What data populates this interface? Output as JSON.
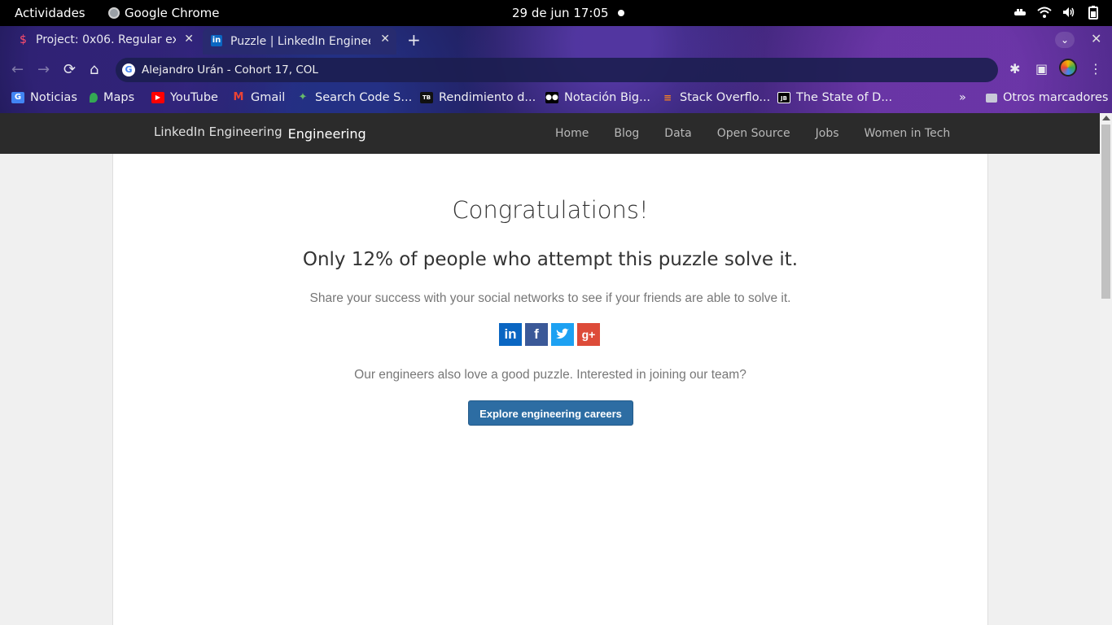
{
  "system": {
    "activities": "Actividades",
    "app_name": "Google Chrome",
    "clock": "29 de jun  17:05"
  },
  "browser": {
    "tabs": [
      {
        "label": "Project: 0x06. Regular exp",
        "favicon": "holberton-icon"
      },
      {
        "label": "Puzzle | LinkedIn Engineering",
        "favicon": "linkedin-icon"
      }
    ],
    "address": "Alejandro Urán - Cohort 17, COL",
    "bookmarks": [
      {
        "label": "Noticias",
        "icon": "google-news-icon",
        "color": "#4285f4"
      },
      {
        "label": "Maps",
        "icon": "maps-pin-icon",
        "color": "#34a853"
      },
      {
        "label": "YouTube",
        "icon": "youtube-icon",
        "color": "#ff0000"
      },
      {
        "label": "Gmail",
        "icon": "gmail-icon",
        "color": "#ea4335"
      },
      {
        "label": "Search Code S...",
        "icon": "search-code-icon",
        "color": "#66bb6a"
      },
      {
        "label": "Rendimiento d...",
        "icon": "video-thumb-icon",
        "color": "#111111"
      },
      {
        "label": "Notación Big...",
        "icon": "medium-icon",
        "color": "#000000"
      },
      {
        "label": "Stack Overflo...",
        "icon": "stackoverflow-icon",
        "color": "#f48024"
      },
      {
        "label": "The State of D...",
        "icon": "jetbrains-icon",
        "color": "#000000"
      }
    ],
    "other_bookmarks": "Otros marcadores"
  },
  "site": {
    "logo_alt": "LinkedIn Engineering",
    "logo_text": "Engineering",
    "nav": [
      "Home",
      "Blog",
      "Data",
      "Open Source",
      "Jobs",
      "Women in Tech"
    ]
  },
  "main": {
    "title": "Congratulations!",
    "subtitle": "Only 12% of people who attempt this puzzle solve it.",
    "share_text": "Share your success with your social networks to see if your friends are able to solve it.",
    "social": [
      {
        "name": "linkedin-share-icon",
        "glyph": "in"
      },
      {
        "name": "facebook-share-icon",
        "glyph": "f"
      },
      {
        "name": "twitter-share-icon",
        "glyph": "t"
      },
      {
        "name": "googleplus-share-icon",
        "glyph": "g+"
      }
    ],
    "careers_text": "Our engineers also love a good puzzle. Interested in joining our team?",
    "cta_label": "Explore engineering careers"
  }
}
